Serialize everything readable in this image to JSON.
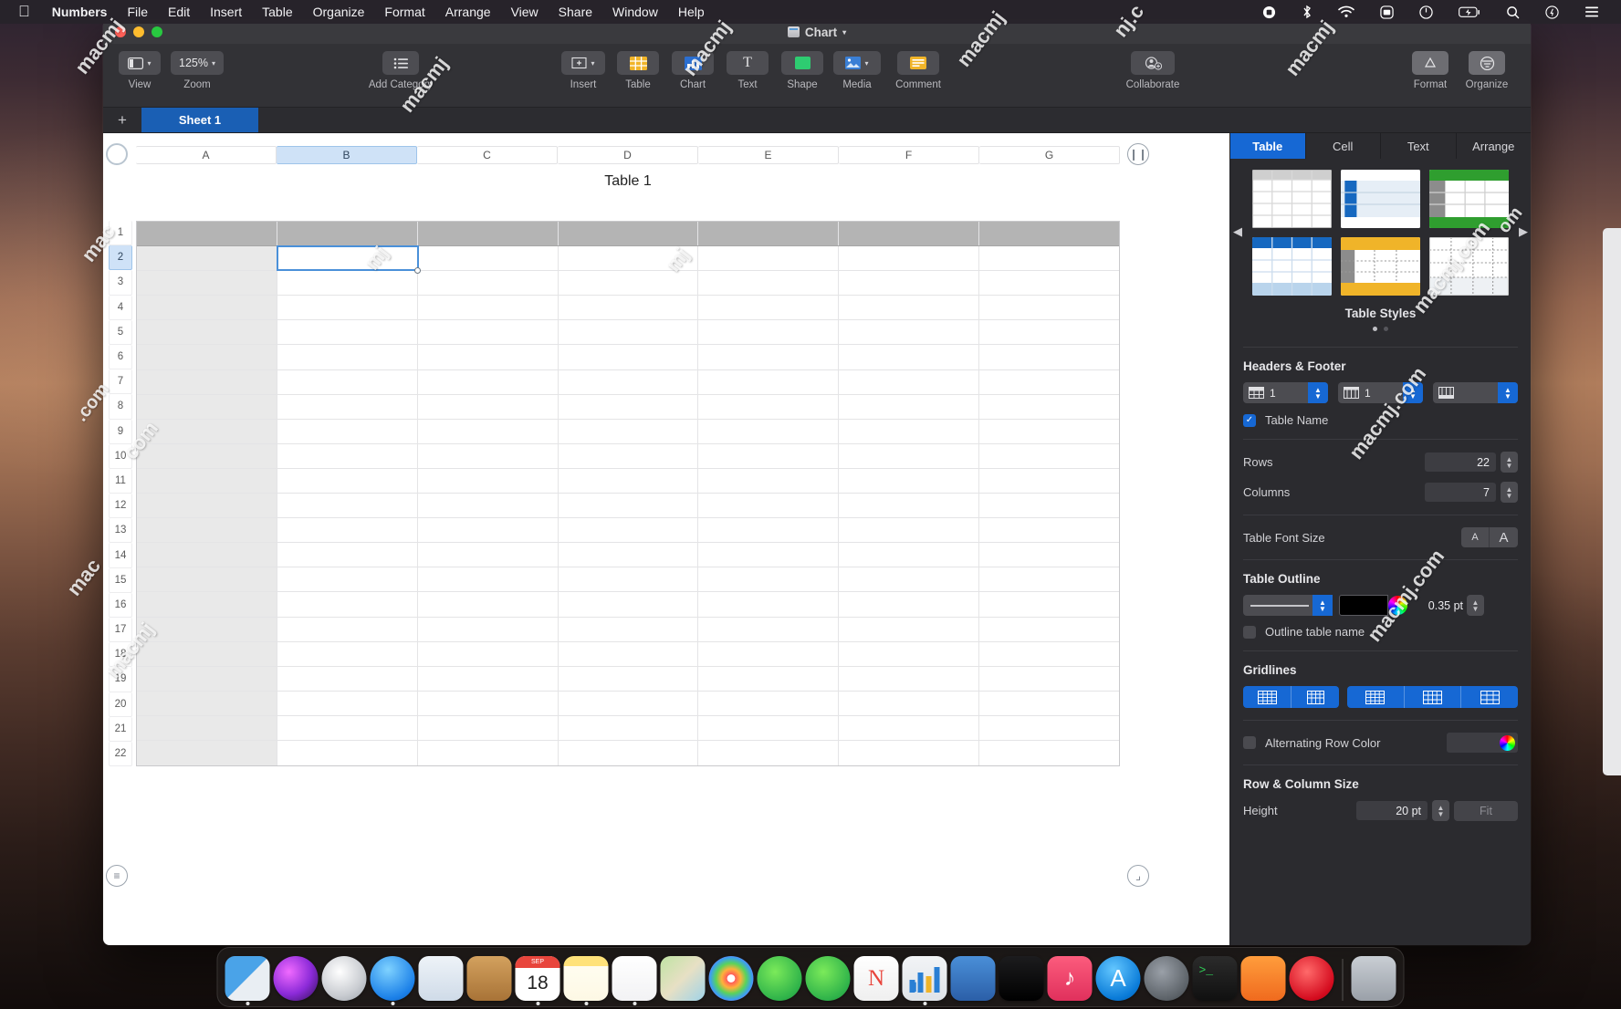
{
  "menubar": {
    "apple_icon": "apple-logo",
    "items": [
      "Numbers",
      "File",
      "Edit",
      "Insert",
      "Table",
      "Organize",
      "Format",
      "Arrange",
      "View",
      "Share",
      "Window",
      "Help"
    ],
    "status_icons": [
      "screen-record-icon",
      "bluetooth-icon",
      "wifi-icon",
      "screen-mirror-icon",
      "control-toggle-icon",
      "battery-icon",
      "search-icon",
      "siri-icon",
      "notification-center-icon"
    ]
  },
  "window": {
    "title": "Chart",
    "traffic_lights": [
      "close",
      "minimize",
      "zoom"
    ]
  },
  "toolbar": {
    "items": [
      {
        "name": "view",
        "label": "View",
        "icon": "sidebar-icon",
        "has_chevron": true
      },
      {
        "name": "zoom",
        "label": "Zoom",
        "value": "125%",
        "has_chevron": true
      },
      {
        "name": "add-category",
        "label": "Add Category",
        "icon": "list-icon"
      },
      {
        "name": "insert",
        "label": "Insert",
        "icon": "insert-icon",
        "has_chevron": true
      },
      {
        "name": "table",
        "label": "Table",
        "icon": "table-icon"
      },
      {
        "name": "chart",
        "label": "Chart",
        "icon": "chart-icon"
      },
      {
        "name": "text",
        "label": "Text",
        "icon": "text-icon"
      },
      {
        "name": "shape",
        "label": "Shape",
        "icon": "shape-icon"
      },
      {
        "name": "media",
        "label": "Media",
        "icon": "media-icon",
        "has_chevron": true
      },
      {
        "name": "comment",
        "label": "Comment",
        "icon": "comment-icon"
      },
      {
        "name": "collaborate",
        "label": "Collaborate",
        "icon": "collaborate-icon"
      },
      {
        "name": "format",
        "label": "Format",
        "icon": "format-icon"
      },
      {
        "name": "organize",
        "label": "Organize",
        "icon": "organize-icon"
      }
    ]
  },
  "sheetbar": {
    "add_label": "+",
    "tabs": [
      "Sheet 1"
    ],
    "active_tab": "Sheet 1"
  },
  "spreadsheet": {
    "table_title": "Table 1",
    "columns": [
      "A",
      "B",
      "C",
      "D",
      "E",
      "F",
      "G"
    ],
    "selected_column": "B",
    "rows": [
      "1",
      "2",
      "3",
      "4",
      "5",
      "6",
      "7",
      "8",
      "9",
      "10",
      "11",
      "12",
      "13",
      "14",
      "15",
      "16",
      "17",
      "18",
      "19",
      "20",
      "21",
      "22"
    ],
    "selected_row": "2",
    "selected_cell": "B2",
    "row_count": 22,
    "column_count": 7,
    "header_rows": 1,
    "cells": []
  },
  "inspector": {
    "tabs": [
      "Table",
      "Cell",
      "Text",
      "Arrange"
    ],
    "active_tab": "Table",
    "styles": {
      "title": "Table Styles",
      "page_dots": 2,
      "active_dot": 0,
      "thumbs": [
        "grey-basic",
        "blue-sidebar",
        "green-header",
        "blue-header",
        "yellow-accent",
        "plain-dotted"
      ]
    },
    "headers_footer": {
      "title": "Headers & Footer",
      "header_rows": "1",
      "header_cols": "1",
      "footer_rows": "",
      "table_name_label": "Table Name",
      "table_name_checked": true
    },
    "size": {
      "rows_label": "Rows",
      "rows_value": "22",
      "columns_label": "Columns",
      "columns_value": "7"
    },
    "font_size": {
      "label": "Table Font Size",
      "small": "A",
      "large": "A"
    },
    "outline": {
      "title": "Table Outline",
      "width_value": "0.35 pt",
      "color": "#000000",
      "outline_name_label": "Outline table name",
      "outline_name_checked": false
    },
    "gridlines": {
      "title": "Gridlines",
      "group1": [
        "header-horizontal-gridlines",
        "header-vertical-gridlines"
      ],
      "group2": [
        "body-horizontal-gridlines",
        "body-vertical-gridlines",
        "body-all-gridlines"
      ]
    },
    "alternating": {
      "label": "Alternating Row Color",
      "checked": false,
      "color": "#ffffff"
    },
    "row_col_size": {
      "title": "Row & Column Size",
      "height_label": "Height",
      "height_value": "20 pt",
      "fit_label": "Fit"
    }
  },
  "dock": {
    "apps": [
      {
        "name": "finder",
        "label": "Finder",
        "running": true
      },
      {
        "name": "siri",
        "label": "Siri",
        "running": false
      },
      {
        "name": "launchpad",
        "label": "Launchpad",
        "running": false
      },
      {
        "name": "safari",
        "label": "Safari",
        "running": true
      },
      {
        "name": "mail",
        "label": "Mail",
        "running": false
      },
      {
        "name": "contacts",
        "label": "Contacts",
        "running": false
      },
      {
        "name": "calendar",
        "label": "Calendar",
        "running": true,
        "badge": "18",
        "badge_month": "SEP"
      },
      {
        "name": "notes",
        "label": "Notes",
        "running": true
      },
      {
        "name": "reminders",
        "label": "Reminders",
        "running": true
      },
      {
        "name": "maps",
        "label": "Maps",
        "running": false
      },
      {
        "name": "photos",
        "label": "Photos",
        "running": false
      },
      {
        "name": "messages",
        "label": "Messages",
        "running": false
      },
      {
        "name": "facetime",
        "label": "FaceTime",
        "running": false
      },
      {
        "name": "news",
        "label": "News",
        "running": false
      },
      {
        "name": "numbers",
        "label": "Numbers",
        "running": true
      },
      {
        "name": "keynote",
        "label": "Keynote",
        "running": false
      },
      {
        "name": "tv",
        "label": "TV",
        "running": false
      },
      {
        "name": "music",
        "label": "Music",
        "running": false
      },
      {
        "name": "appstore",
        "label": "App Store",
        "running": false
      },
      {
        "name": "system-preferences",
        "label": "System Preferences",
        "running": false
      },
      {
        "name": "terminal",
        "label": "Terminal",
        "running": false
      },
      {
        "name": "home",
        "label": "Home",
        "running": false
      },
      {
        "name": "opera",
        "label": "Opera",
        "running": false
      },
      {
        "name": "trash",
        "label": "Trash",
        "running": false
      }
    ]
  },
  "watermarks": [
    "macmj",
    "macmj.com",
    "macmj.c"
  ],
  "colors": {
    "accent_blue": "#1668d4",
    "selection_blue": "#4a90d9",
    "header_grey": "#b4b4b4",
    "panel_bg": "#2b2b2f",
    "toolbar_bg": "#323236"
  }
}
